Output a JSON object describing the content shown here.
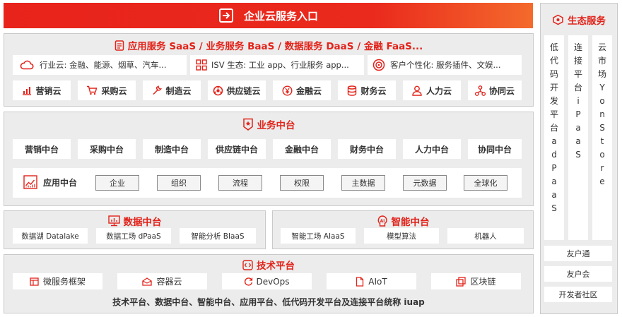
{
  "entry": {
    "label": "企业云服务入口",
    "icon": "login-icon"
  },
  "services": {
    "title": "应用服务 SaaS / 业务服务 BaaS / 数据服务 DaaS / 金融 FaaS...",
    "icon": "document-icon",
    "row1": [
      {
        "label": "行业云: 金融、能源、烟草、汽车...",
        "icon": "cloud-icon"
      },
      {
        "label": "ISV 生态: 工业 app、行业服务 app...",
        "icon": "grid-icon"
      },
      {
        "label": "客户个性化: 服务插件、文娱...",
        "icon": "target-icon"
      }
    ],
    "row2": [
      {
        "label": "营销云",
        "icon": "bar-chart-icon"
      },
      {
        "label": "采购云",
        "icon": "cart-icon"
      },
      {
        "label": "制造云",
        "icon": "wrench-icon"
      },
      {
        "label": "供应链云",
        "icon": "supply-chain-icon"
      },
      {
        "label": "金融云",
        "icon": "yen-icon"
      },
      {
        "label": "财务云",
        "icon": "database-icon"
      },
      {
        "label": "人力云",
        "icon": "person-icon"
      },
      {
        "label": "协同云",
        "icon": "network-icon"
      }
    ]
  },
  "business": {
    "title": "业务中台",
    "icon": "shield-star-icon",
    "items": [
      "营销中台",
      "采购中台",
      "制造中台",
      "供应链中台",
      "金融中台",
      "财务中台",
      "人力中台",
      "协同中台"
    ],
    "app_platform": {
      "label": "应用中台",
      "icon": "chart-line-icon",
      "tags": [
        "企业",
        "组织",
        "流程",
        "权限",
        "主数据",
        "元数据",
        "全球化"
      ]
    }
  },
  "data_platform": {
    "title": "数据中台",
    "icon": "monitor-chart-icon",
    "items": [
      "数据湖 Datalake",
      "数据工场 dPaaS",
      "智能分析 BIaaS"
    ]
  },
  "ai_platform": {
    "title": "智能中台",
    "icon": "ai-icon",
    "items": [
      "智能工场 AIaaS",
      "模型算法",
      "机器人"
    ]
  },
  "tech_platform": {
    "title": "技术平台",
    "icon": "code-icon",
    "items": [
      {
        "label": "微服务框架",
        "icon": "window-icon"
      },
      {
        "label": "容器云",
        "icon": "container-icon"
      },
      {
        "label": "DevOps",
        "icon": "devops-icon"
      },
      {
        "label": "AIoT",
        "icon": "aiot-icon"
      },
      {
        "label": "区块链",
        "icon": "blockchain-icon"
      }
    ],
    "footer": "技术平台、数据中台、智能中台、应用平台、低代码开发平台及连接平台统称 iuap"
  },
  "ecosystem": {
    "title": "生态服务",
    "icon": "ecosystem-icon",
    "columns": [
      [
        "低",
        "代",
        "码",
        "开",
        "发",
        "平",
        "台",
        "a",
        "d",
        "P",
        "a",
        "a",
        "S"
      ],
      [
        "连",
        "接",
        "平",
        "台",
        "i",
        "P",
        "a",
        "a",
        "S"
      ],
      [
        "云",
        "市",
        "场",
        "Y",
        "o",
        "n",
        "S",
        "t",
        "o",
        "r",
        "e"
      ]
    ],
    "buttons": [
      "友户通",
      "友户会",
      "开发者社区"
    ]
  },
  "colors": {
    "accent": "#e2231a",
    "banner_start": "#e8231b",
    "banner_end": "#f46a2c",
    "panel": "#ececec"
  }
}
